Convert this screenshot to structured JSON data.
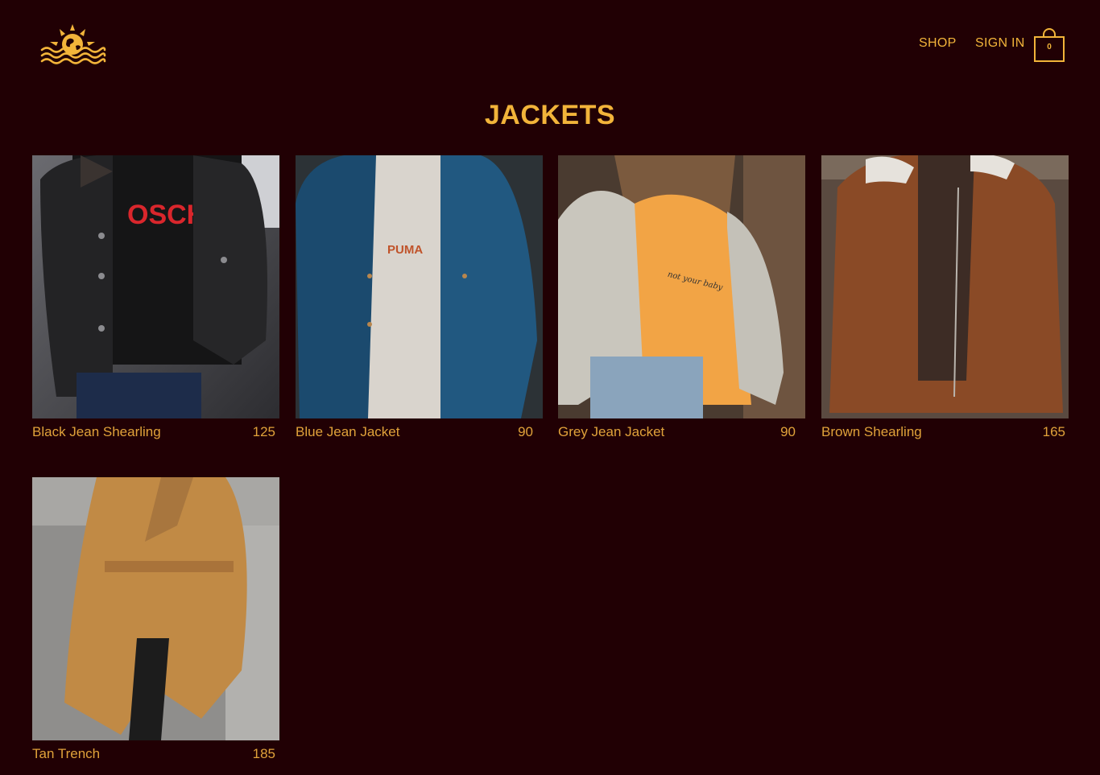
{
  "header": {
    "logo_icon": "sun-waves-logo-icon",
    "nav": {
      "shop": "SHOP",
      "sign_in": "SIGN IN"
    },
    "cart": {
      "icon": "shopping-bag-icon",
      "count": "0"
    }
  },
  "page": {
    "title": "JACKETS"
  },
  "products": [
    {
      "name": "Black Jean Shearling",
      "price": "125"
    },
    {
      "name": "Blue Jean Jacket",
      "price": "90"
    },
    {
      "name": "Grey Jean Jacket",
      "price": "90"
    },
    {
      "name": "Brown Shearling",
      "price": "165"
    },
    {
      "name": "Tan Trench",
      "price": "185"
    }
  ],
  "colors": {
    "background": "#210004",
    "accent": "#f2b43a",
    "text": "#e0a23a"
  }
}
